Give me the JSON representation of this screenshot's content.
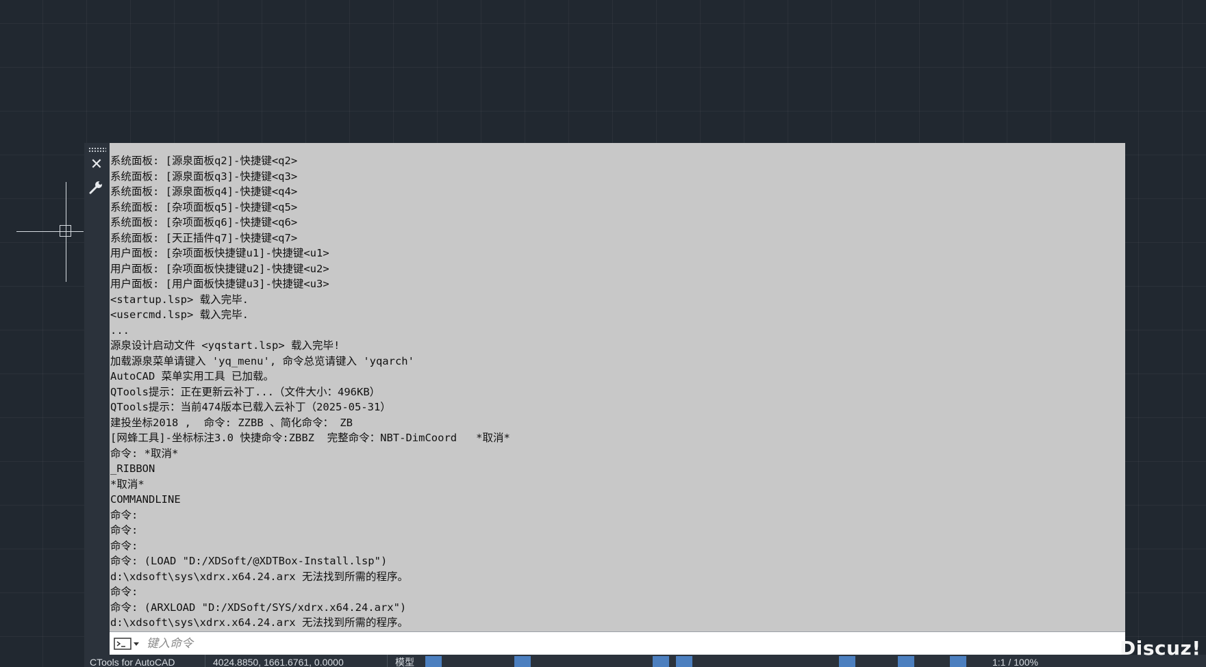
{
  "history": {
    "lines": [
      "系统面板: [源泉面板q2]-快捷键<q2>",
      "系统面板: [源泉面板q3]-快捷键<q3>",
      "系统面板: [源泉面板q4]-快捷键<q4>",
      "系统面板: [杂项面板q5]-快捷键<q5>",
      "系统面板: [杂项面板q6]-快捷键<q6>",
      "系统面板: [天正插件q7]-快捷键<q7>",
      "用户面板: [杂项面板快捷键u1]-快捷键<u1>",
      "用户面板: [杂项面板快捷键u2]-快捷键<u2>",
      "用户面板: [用户面板快捷键u3]-快捷键<u3>",
      "<startup.lsp> 载入完毕.",
      "<usercmd.lsp> 载入完毕.",
      "...",
      "源泉设计启动文件 <yqstart.lsp> 载入完毕!",
      "加载源泉菜单请键入 'yq_menu', 命令总览请键入 'yqarch'",
      "AutoCAD 菜单实用工具 已加载。",
      "QTools提示：正在更新云补丁...（文件大小：496KB）",
      "QTools提示：当前474版本已载入云补丁（2025-05-31）",
      "建投坐标2018 ,  命令: ZZBB 、简化命令： ZB",
      "[网蜂工具]-坐标标注3.0 快捷命令:ZBBZ  完整命令：NBT-DimCoord   *取消*",
      "命令: *取消*",
      "_RIBBON",
      "*取消*",
      "COMMANDLINE",
      "命令:",
      "命令:",
      "命令:",
      "命令: (LOAD \"D:/XDSoft/@XDTBox-Install.lsp\")",
      "d:\\xdsoft\\sys\\xdrx.x64.24.arx 无法找到所需的程序。",
      "命令:",
      "命令: (ARXLOAD \"D:/XDSoft/SYS/xdrx.x64.24.arx\")",
      "d:\\xdsoft\\sys\\xdrx.x64.24.arx 无法找到所需的程序。"
    ]
  },
  "command_input": {
    "placeholder": "键入命令",
    "value": ""
  },
  "sidebar": {
    "close_glyph": "✕"
  },
  "statusbar": {
    "app_label": "CTools for AutoCAD",
    "coordinates": "4024.8850, 1661.6761, 0.0000",
    "model_label": "模型",
    "zoom": "1:1 / 100%"
  },
  "watermark": {
    "text": "Discuz!"
  },
  "colors": {
    "canvas_bg": "#212830",
    "history_bg": "#c8c8c8",
    "sidebar_bg": "#2b323b",
    "active_button": "#4c7fbf"
  }
}
